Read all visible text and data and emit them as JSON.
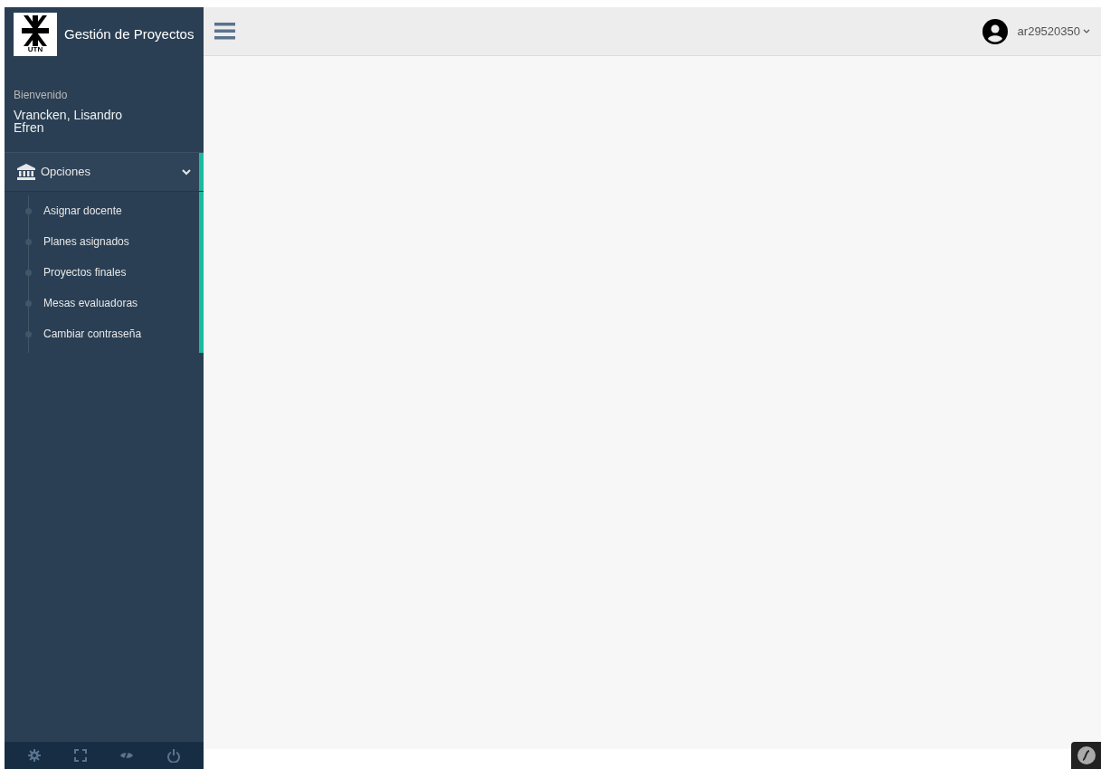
{
  "app": {
    "title": "Gestión de Proyectos",
    "logo_text": "UTN"
  },
  "welcome": {
    "greeting": "Bienvenido",
    "user_name": "Vrancken, Lisandro\nEfren"
  },
  "menu": {
    "label": "Opciones",
    "expanded": true,
    "items": [
      {
        "label": "Asignar docente"
      },
      {
        "label": "Planes asignados"
      },
      {
        "label": "Proyectos finales"
      },
      {
        "label": "Mesas evaluadoras"
      },
      {
        "label": "Cambiar contraseña"
      }
    ]
  },
  "top_bar": {
    "username": "ar29520350"
  }
}
